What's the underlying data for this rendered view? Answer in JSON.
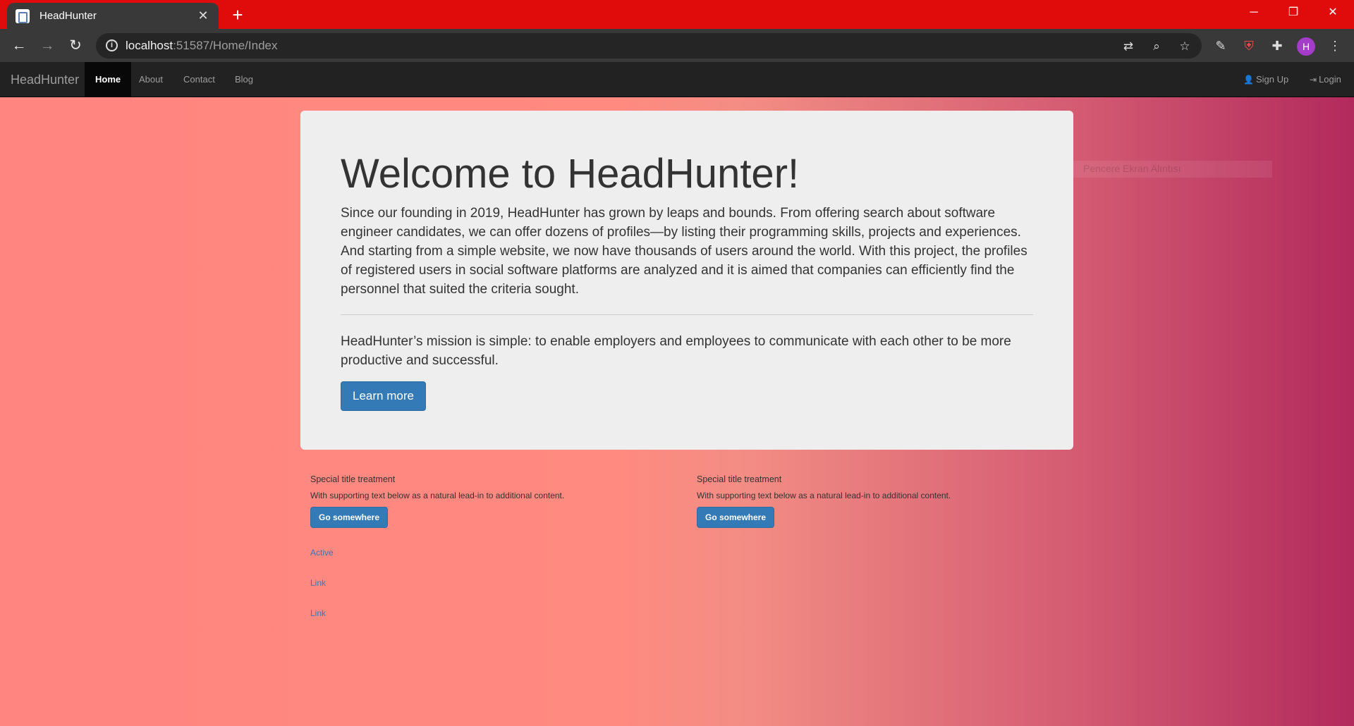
{
  "browser": {
    "tab_title": "HeadHunter",
    "new_tab": "+",
    "url_host": "localhost",
    "url_rest": ":51587/Home/Index",
    "avatar_letter": "H",
    "window": {
      "minimize": "─",
      "restore": "❐",
      "close": "✕"
    },
    "frame_color": "#e00b0b"
  },
  "nav": {
    "brand": "HeadHunter",
    "items": [
      {
        "label": "Home",
        "active": true
      },
      {
        "label": "About"
      },
      {
        "label": "Contact"
      },
      {
        "label": "Blog"
      }
    ],
    "right": {
      "signup": "Sign Up",
      "login": "Login"
    }
  },
  "jumbotron": {
    "title": "Welcome to HeadHunter!",
    "lead": "Since our founding in 2019, HeadHunter has grown by leaps and bounds. From offering search about software engineer candidates, we can offer dozens of profiles—by listing their programming skills, projects and experiences. And starting from a simple website, we now have thousands of users around the world. With this project, the profiles of registered users in social software platforms are analyzed and it is aimed that companies can efficiently find the personnel that suited the criteria sought.",
    "mission": "HeadHunter’s mission is simple: to enable employers and employees to communicate with each other to be more productive and successful.",
    "button": "Learn more"
  },
  "cards": [
    {
      "title": "Special title treatment",
      "text": "With supporting text below as a natural lead-in to additional content.",
      "button": "Go somewhere"
    },
    {
      "title": "Special title treatment",
      "text": "With supporting text below as a natural lead-in to additional content.",
      "button": "Go somewhere"
    }
  ],
  "links": [
    "Active",
    "Link",
    "Link"
  ],
  "overlay_text": "Pencere Ekran Alıntısı",
  "colors": {
    "primary": "#337ab7",
    "navbar": "#222222",
    "jumbotron": "#eeeeee"
  }
}
